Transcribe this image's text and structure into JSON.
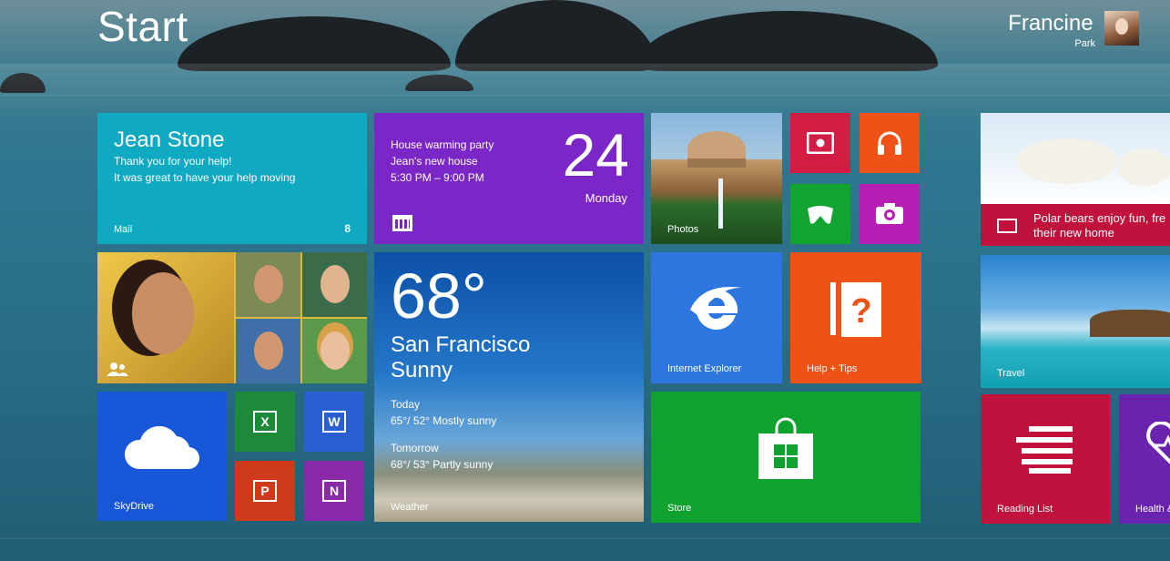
{
  "header": {
    "title": "Start"
  },
  "user": {
    "first_name": "Francine",
    "last_name": "Park"
  },
  "tiles": {
    "mail": {
      "label": "Mail",
      "badge": "8",
      "sender": "Jean Stone",
      "line1": "Thank you for your help!",
      "line2": "It was great to have your help moving",
      "color": "#0fa9c2"
    },
    "calendar": {
      "event": "House warming party",
      "location": "Jean's new house",
      "time": "5:30 PM – 9:00 PM",
      "day": "24",
      "weekday": "Monday",
      "color": "#7b26c7"
    },
    "photos": {
      "label": "Photos"
    },
    "video": {
      "icon": "video-icon",
      "color": "#d21e45"
    },
    "music": {
      "icon": "headphones-icon",
      "color": "#ee5216"
    },
    "games": {
      "icon": "gamepad-icon",
      "color": "#12a331"
    },
    "camera": {
      "icon": "camera-icon",
      "color": "#b61fb3"
    },
    "news": {
      "headline": "Polar bears enjoy fun, fre their new home",
      "color": "#c0123d"
    },
    "people": {
      "icon": "people-icon"
    },
    "weather": {
      "label": "Weather",
      "temp": "68°",
      "city": "San Francisco",
      "condition": "Sunny",
      "today_label": "Today",
      "today": "65°/ 52° Mostly sunny",
      "tomorrow_label": "Tomorrow",
      "tomorrow": "68°/ 53° Partly sunny"
    },
    "ie": {
      "label": "Internet Explorer",
      "color": "#2d76e0"
    },
    "help": {
      "label": "Help + Tips",
      "color": "#ee5216"
    },
    "travel": {
      "label": "Travel"
    },
    "skydrive": {
      "label": "SkyDrive",
      "color": "#1857d8"
    },
    "excel": {
      "glyph": "X"
    },
    "word": {
      "glyph": "W"
    },
    "powerpoint": {
      "glyph": "P"
    },
    "onenote": {
      "glyph": "N"
    },
    "store": {
      "label": "Store",
      "color": "#0fa22f"
    },
    "reading_list": {
      "label": "Reading List"
    },
    "health": {
      "label": "Health &"
    }
  }
}
